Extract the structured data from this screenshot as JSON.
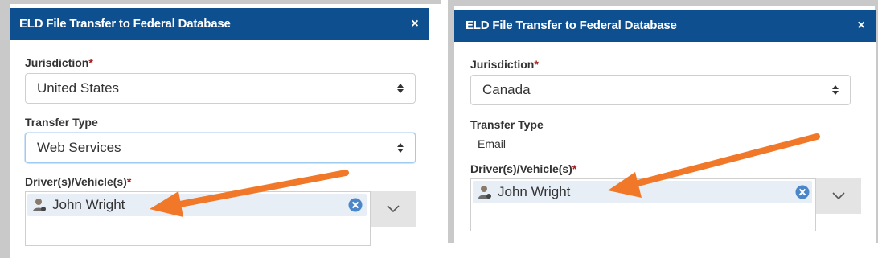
{
  "left_dialog": {
    "title": "ELD File Transfer to Federal Database",
    "close_glyph": "×",
    "jurisdiction_label": "Jurisdiction",
    "required_marker": "*",
    "jurisdiction_value": "United States",
    "transfer_type_label": "Transfer Type",
    "transfer_type_value": "Web Services",
    "drivers_label": "Driver(s)/Vehicle(s)",
    "selected_driver": "John Wright"
  },
  "right_dialog": {
    "title": "ELD File Transfer to Federal Database",
    "close_glyph": "×",
    "jurisdiction_label": "Jurisdiction",
    "required_marker": "*",
    "jurisdiction_value": "Canada",
    "transfer_type_label": "Transfer Type",
    "transfer_type_value": "Email",
    "drivers_label": "Driver(s)/Vehicle(s)",
    "selected_driver": "John Wright"
  },
  "annotation": {
    "arrow_color": "#f07828"
  },
  "colors": {
    "titlebar": "#0e4f8f",
    "chip_background": "#e8eef6",
    "required": "#a51c1c"
  },
  "icons": [
    "close-icon",
    "select-arrows-icon",
    "driver-avatar-icon",
    "remove-circle-icon",
    "chevron-down-icon"
  ]
}
